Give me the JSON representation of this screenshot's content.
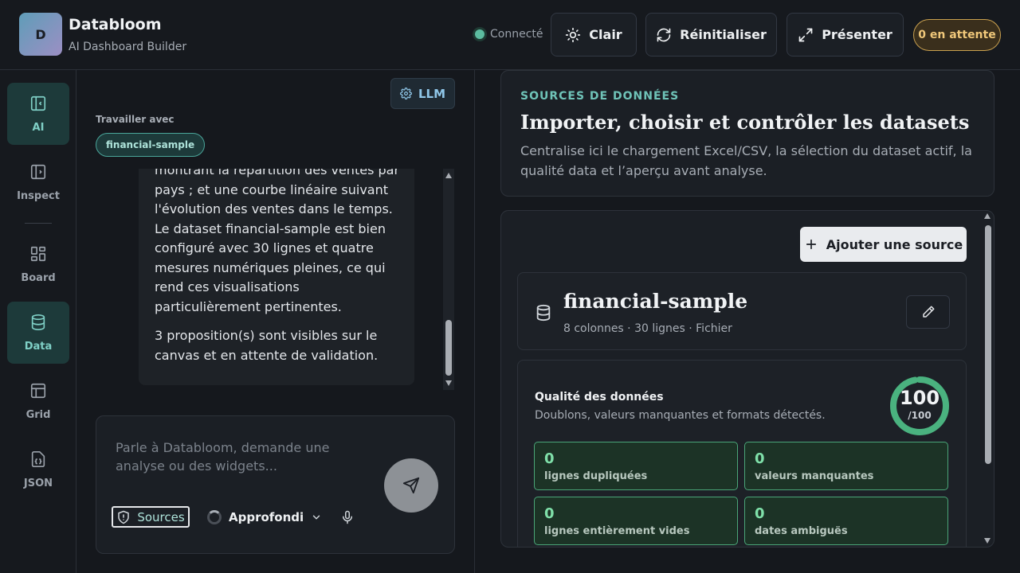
{
  "app": {
    "logo_letter": "D",
    "name": "Databloom",
    "subtitle": "AI Dashboard Builder"
  },
  "header": {
    "status": "Connecté",
    "theme_label": "Clair",
    "reset_label": "Réinitialiser",
    "present_label": "Présenter",
    "pending_label": "0 en attente"
  },
  "sidebar": {
    "items": [
      {
        "label": "AI",
        "icon": "panel-left-icon",
        "active": true
      },
      {
        "label": "Inspect",
        "icon": "panel-right-icon",
        "active": false
      },
      {
        "label": "Board",
        "icon": "grid-icon",
        "active": false
      },
      {
        "label": "Data",
        "icon": "database-icon",
        "active": true
      },
      {
        "label": "Grid",
        "icon": "table-icon",
        "active": false
      },
      {
        "label": "JSON",
        "icon": "json-icon",
        "active": false
      }
    ]
  },
  "chat": {
    "llm_label": "LLM",
    "work_with_label": "Travailler avec",
    "dataset_chip": "financial-sample",
    "message_p1": "montrant la répartition des ventes par pays ; et une courbe linéaire suivant l'évolution des ventes dans le temps. Le dataset financial-sample est bien configuré avec 30 lignes et quatre mesures numériques pleines, ce qui rend ces visualisations particulièrement pertinentes.",
    "message_p2": "3 proposition(s) sont visibles sur le canvas et en attente de validation.",
    "composer_placeholder": "Parle à Databloom, demande une analyse ou des widgets...",
    "sources_label": "Sources",
    "mode_label": "Approfondi"
  },
  "data_panel": {
    "eyebrow": "SOURCES DE DONNÉES",
    "title": "Importer, choisir et contrôler les datasets",
    "description": "Centralise ici le chargement Excel/CSV, la sélection du dataset actif, la qualité data et l’aperçu avant analyse.",
    "add_source_label": "Ajouter une source",
    "dataset": {
      "name": "financial-sample",
      "meta": "8 colonnes · 30 lignes · Fichier"
    },
    "quality": {
      "title": "Qualité des données",
      "subtitle": "Doublons, valeurs manquantes et formats détectés.",
      "score": "100",
      "score_max": "/100",
      "score_fraction": 1.0,
      "metrics": [
        {
          "value": "0",
          "label": "lignes dupliquées"
        },
        {
          "value": "0",
          "label": "valeurs manquantes"
        },
        {
          "value": "0",
          "label": "lignes entièrement vides"
        },
        {
          "value": "0",
          "label": "dates ambiguës"
        }
      ]
    }
  },
  "colors": {
    "accent": "#6fc3b8",
    "success": "#5cbca0",
    "warning": "#c9a04f"
  }
}
